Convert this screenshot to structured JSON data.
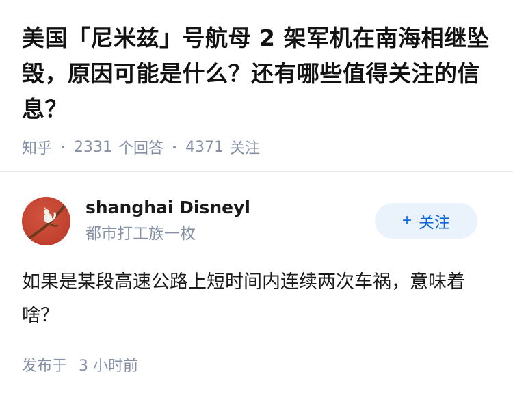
{
  "question": {
    "title": "美国「尼米兹」号航母 2 架军机在南海相继坠毁，原因可能是什么？还有哪些值得关注的信息？",
    "source": "知乎",
    "answers_count": "2331",
    "answers_label": "个回答",
    "followers_count": "4371",
    "followers_label": "关注"
  },
  "author": {
    "name": "shanghai Disneyl",
    "bio": "都市打工族一枚",
    "avatar_icon": "avatar-image-icon",
    "follow_label": "关注",
    "follow_icon": "plus-icon",
    "accent_color": "#0a66d9"
  },
  "answer": {
    "text": "如果是某段高速公路上短时间内连续两次车祸，意味着啥？"
  },
  "publish": {
    "label": "发布于",
    "time": "3 小时前"
  }
}
